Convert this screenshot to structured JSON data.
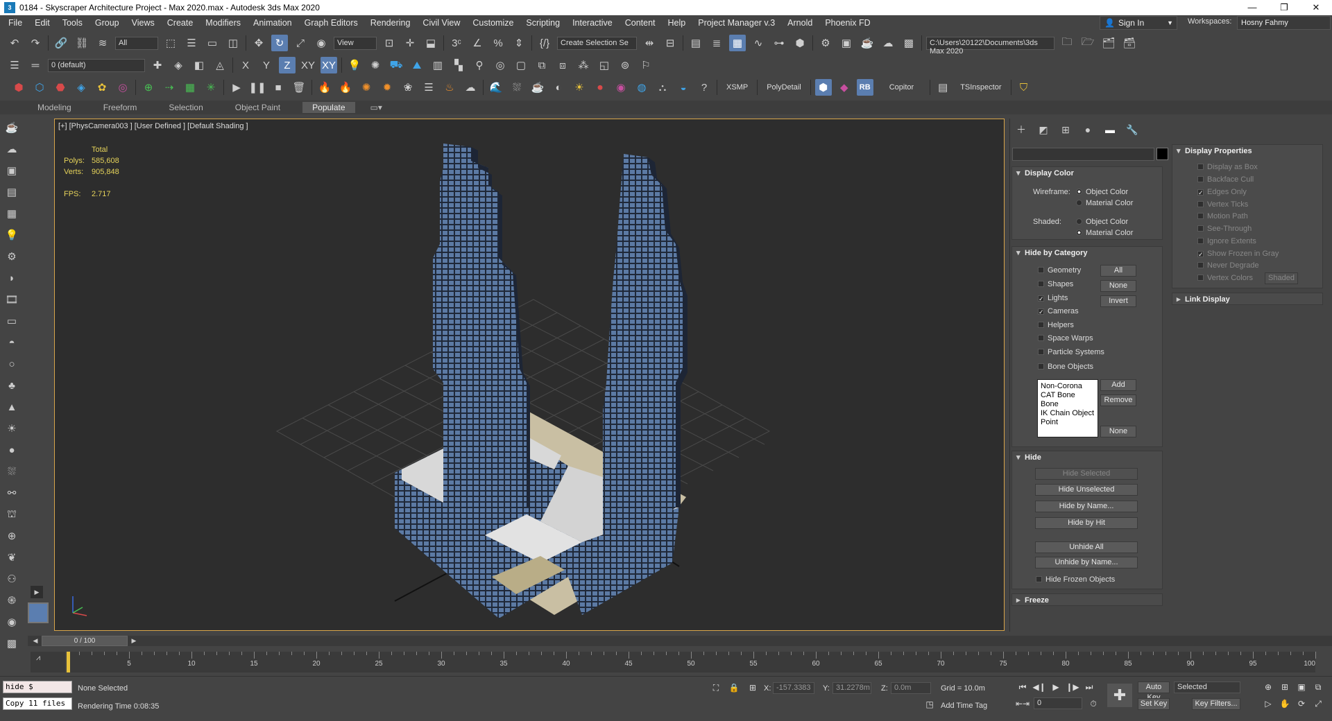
{
  "window": {
    "title": "0184 - Skyscraper Architecture Project - Max 2020.max - Autodesk 3ds Max 2020",
    "controls": [
      "—",
      "❐",
      "✕"
    ]
  },
  "menubar": {
    "items": [
      "File",
      "Edit",
      "Tools",
      "Group",
      "Views",
      "Create",
      "Modifiers",
      "Animation",
      "Graph Editors",
      "Rendering",
      "Civil View",
      "Customize",
      "Scripting",
      "Interactive",
      "Content",
      "Help",
      "Project Manager v.3",
      "Arnold",
      "Phoenix FD"
    ],
    "sign_in": "Sign In",
    "workspaces_label": "Workspaces:",
    "workspace_value": "Hosny Fahmy"
  },
  "toolbar_main": {
    "selection_filter": "All",
    "ref_coord": "View",
    "named_selection": "Create Selection Se",
    "project_path": "C:\\Users\\20122\\Documents\\3ds Max 2020"
  },
  "toolbar_second": {
    "layer": "0 (default)",
    "axis_x": "X",
    "axis_y": "Y",
    "axis_z": "Z",
    "axis_xy": "XY",
    "axis_xy2": "XY"
  },
  "toolbar_third": {
    "xsmp": "XSMP",
    "polydetail": "PolyDetail",
    "rb": "RB",
    "copitor": "Copitor",
    "tsinspector": "TSInspector"
  },
  "ribbon": {
    "tabs": [
      "Modeling",
      "Freeform",
      "Selection",
      "Object Paint",
      "Populate"
    ],
    "active": "Populate"
  },
  "viewport": {
    "label": "[+] [PhysCamera003 ] [User Defined ] [Default Shading ]",
    "stats": {
      "header": "Total",
      "polys_label": "Polys:",
      "polys_value": "585,608",
      "verts_label": "Verts:",
      "verts_value": "905,848",
      "fps_label": "FPS:",
      "fps_value": "2.717"
    }
  },
  "command_panel": {
    "display_color": {
      "title": "Display Color",
      "wireframe_label": "Wireframe:",
      "shaded_label": "Shaded:",
      "object_color": "Object Color",
      "material_color": "Material Color"
    },
    "hide_by_category": {
      "title": "Hide by Category",
      "categories": [
        {
          "label": "Geometry",
          "checked": false
        },
        {
          "label": "Shapes",
          "checked": false
        },
        {
          "label": "Lights",
          "checked": true
        },
        {
          "label": "Cameras",
          "checked": true
        },
        {
          "label": "Helpers",
          "checked": false
        },
        {
          "label": "Space Warps",
          "checked": false
        },
        {
          "label": "Particle Systems",
          "checked": false
        },
        {
          "label": "Bone Objects",
          "checked": false
        }
      ],
      "btn_all": "All",
      "btn_none": "None",
      "btn_invert": "Invert",
      "list_items": [
        "Non-Corona",
        "CAT Bone",
        "Bone",
        "IK Chain Object",
        "Point"
      ],
      "btn_add": "Add",
      "btn_remove": "Remove",
      "btn_none2": "None"
    },
    "hide": {
      "title": "Hide",
      "hide_selected": "Hide Selected",
      "hide_unselected": "Hide Unselected",
      "hide_by_name": "Hide by Name...",
      "hide_by_hit": "Hide by Hit",
      "unhide_all": "Unhide All",
      "unhide_by_name": "Unhide by Name...",
      "hide_frozen": "Hide Frozen Objects"
    },
    "freeze": {
      "title": "Freeze"
    },
    "display_properties": {
      "title": "Display Properties",
      "items": [
        {
          "label": "Display as Box",
          "checked": false
        },
        {
          "label": "Backface Cull",
          "checked": false
        },
        {
          "label": "Edges Only",
          "checked": true
        },
        {
          "label": "Vertex Ticks",
          "checked": false
        },
        {
          "label": "Motion Path",
          "checked": false
        },
        {
          "label": "See-Through",
          "checked": false
        },
        {
          "label": "Ignore Extents",
          "checked": false
        },
        {
          "label": "Show Frozen in Gray",
          "checked": true
        },
        {
          "label": "Never Degrade",
          "checked": false
        },
        {
          "label": "Vertex Colors",
          "checked": false
        }
      ],
      "shaded_btn": "Shaded"
    },
    "link_display": {
      "title": "Link Display"
    }
  },
  "timeline": {
    "slider_label": "0 / 100",
    "ticks": [
      "5",
      "10",
      "15",
      "20",
      "25",
      "30",
      "35",
      "40",
      "45",
      "50",
      "55",
      "60",
      "65",
      "70",
      "75",
      "80",
      "85",
      "90",
      "95",
      "100"
    ]
  },
  "status": {
    "maxscript_line1": "hide $",
    "maxscript_line2": "Copy 11 files",
    "selection_status": "None Selected",
    "rendering_time": "Rendering Time  0:08:35",
    "x_label": "X:",
    "x_value": "-157.3383",
    "y_label": "Y:",
    "y_value": "31.2278m",
    "z_label": "Z:",
    "z_value": "0.0m",
    "grid": "Grid = 10.0m",
    "add_time_tag": "Add Time Tag",
    "auto_key": "Auto Key",
    "set_key": "Set Key",
    "selected_dropdown": "Selected",
    "key_filters": "Key Filters...",
    "frame_value": "0"
  },
  "colors": {
    "viewport_border": "#d9a64a",
    "active_blue": "#5b7eb0",
    "stats_yellow": "#e6d35a"
  }
}
